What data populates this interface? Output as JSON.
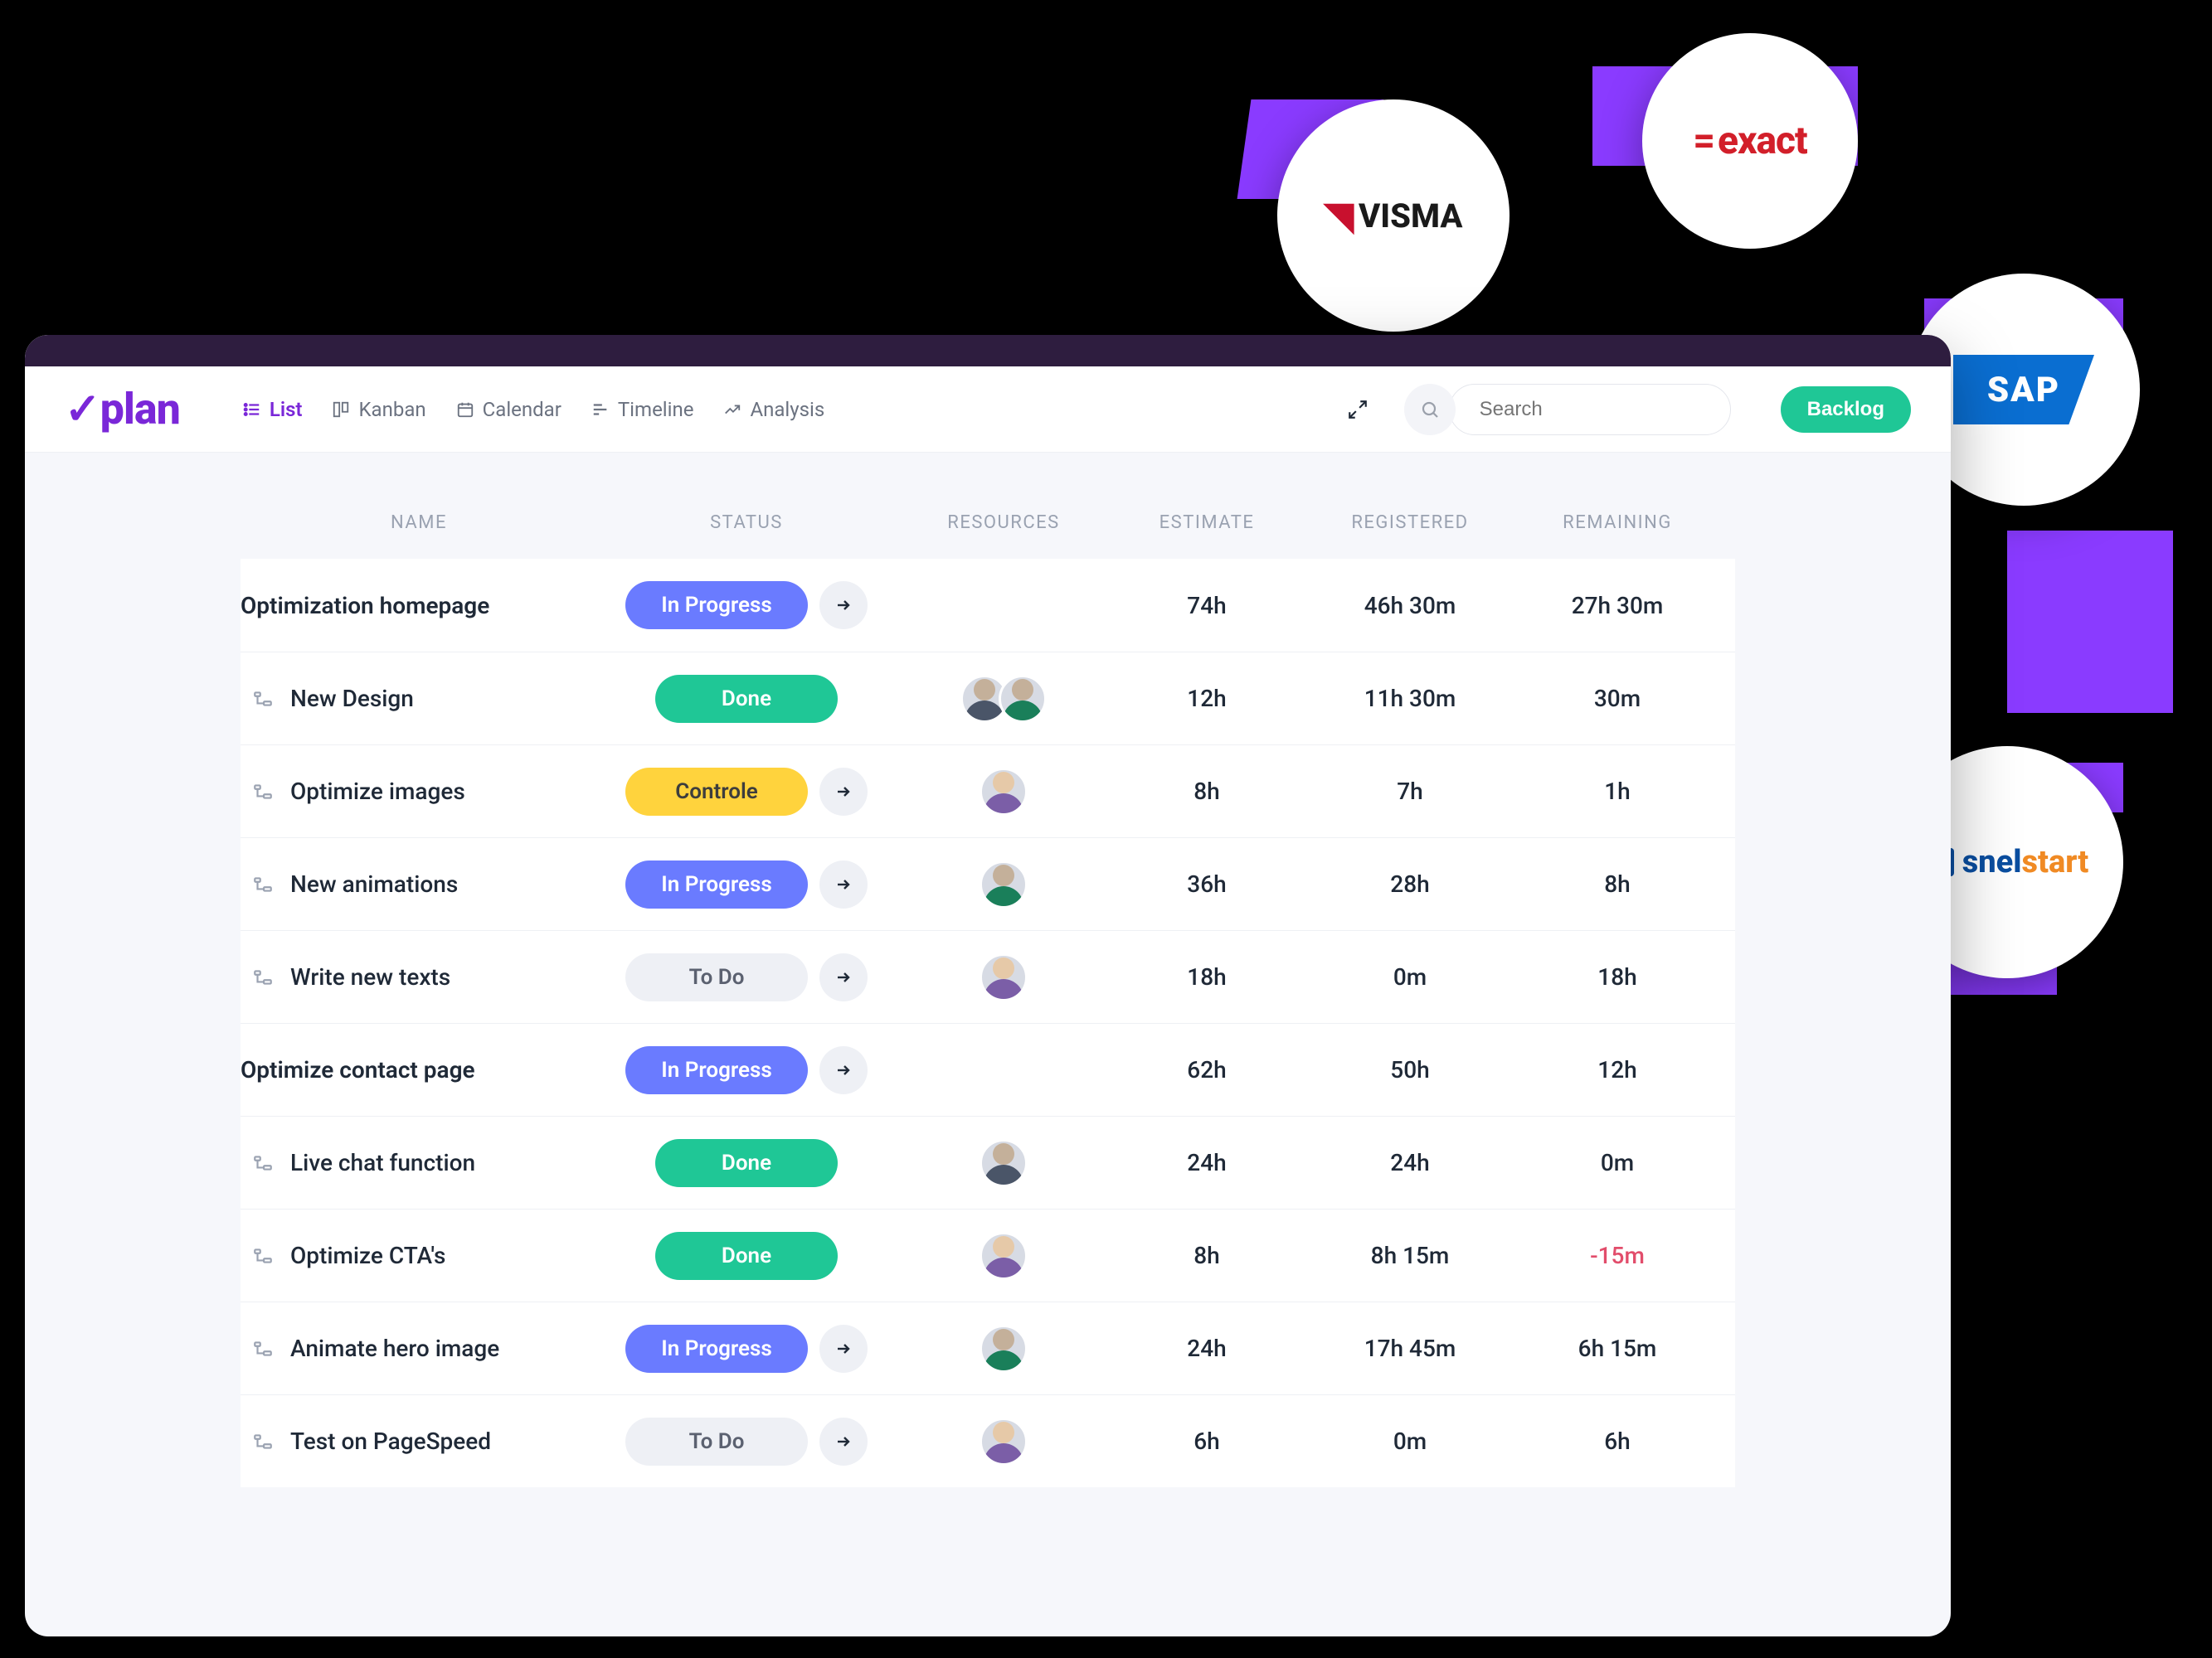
{
  "app": {
    "logo_text": "plan"
  },
  "nav": {
    "list": "List",
    "kanban": "Kanban",
    "calendar": "Calendar",
    "timeline": "Timeline",
    "analysis": "Analysis"
  },
  "search": {
    "placeholder": "Search"
  },
  "backlog_label": "Backlog",
  "columns": {
    "name": "NAME",
    "status": "STATUS",
    "resources": "RESOURCES",
    "estimate": "ESTIMATE",
    "registered": "REGISTERED",
    "remaining": "REMAINING"
  },
  "status_labels": {
    "todo": "To Do",
    "progress": "In Progress",
    "done": "Done",
    "control": "Controle"
  },
  "rows": [
    {
      "name": "Optimization homepage",
      "type": "parent",
      "status": "progress",
      "arrow": true,
      "avatars": [],
      "estimate": "74h",
      "registered": "46h 30m",
      "remaining": "27h 30m",
      "neg": false
    },
    {
      "name": "New Design",
      "type": "child",
      "status": "done",
      "arrow": false,
      "avatars": [
        "m",
        "b"
      ],
      "estimate": "12h",
      "registered": "11h 30m",
      "remaining": "30m",
      "neg": false
    },
    {
      "name": "Optimize images",
      "type": "child",
      "status": "control",
      "arrow": true,
      "avatars": [
        "f"
      ],
      "estimate": "8h",
      "registered": "7h",
      "remaining": "1h",
      "neg": false
    },
    {
      "name": "New animations",
      "type": "child",
      "status": "progress",
      "arrow": true,
      "avatars": [
        "b"
      ],
      "estimate": "36h",
      "registered": "28h",
      "remaining": "8h",
      "neg": false
    },
    {
      "name": "Write new texts",
      "type": "child",
      "status": "todo",
      "arrow": true,
      "avatars": [
        "f"
      ],
      "estimate": "18h",
      "registered": "0m",
      "remaining": "18h",
      "neg": false
    },
    {
      "name": "Optimize contact page",
      "type": "parent",
      "status": "progress",
      "arrow": true,
      "avatars": [],
      "estimate": "62h",
      "registered": "50h",
      "remaining": "12h",
      "neg": false
    },
    {
      "name": "Live chat function",
      "type": "child",
      "status": "done",
      "arrow": false,
      "avatars": [
        "m"
      ],
      "estimate": "24h",
      "registered": "24h",
      "remaining": "0m",
      "neg": false
    },
    {
      "name": "Optimize CTA's",
      "type": "child",
      "status": "done",
      "arrow": false,
      "avatars": [
        "f"
      ],
      "estimate": "8h",
      "registered": "8h 15m",
      "remaining": "-15m",
      "neg": true
    },
    {
      "name": "Animate hero image",
      "type": "child",
      "status": "progress",
      "arrow": true,
      "avatars": [
        "b"
      ],
      "estimate": "24h",
      "registered": "17h 45m",
      "remaining": "6h 15m",
      "neg": false
    },
    {
      "name": "Test on PageSpeed",
      "type": "child",
      "status": "todo",
      "arrow": true,
      "avatars": [
        "f"
      ],
      "estimate": "6h",
      "registered": "0m",
      "remaining": "6h",
      "neg": false
    }
  ],
  "integrations": {
    "visma": "VISMA",
    "exact": "exact",
    "sap": "SAP",
    "snelstart_a": "snel",
    "snelstart_b": "start"
  }
}
